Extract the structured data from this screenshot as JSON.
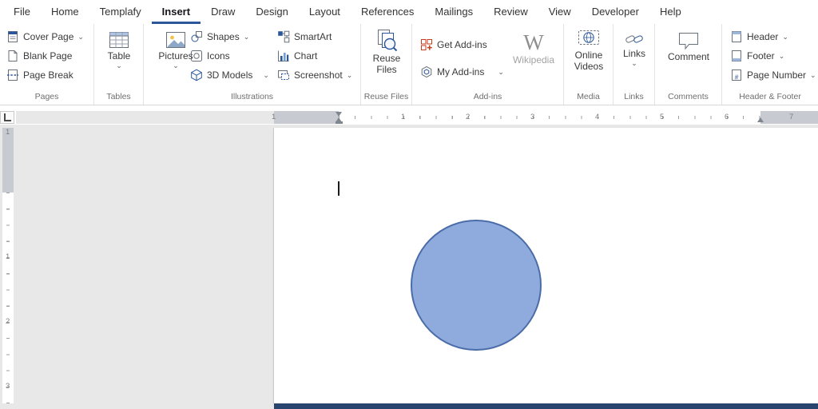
{
  "menu": {
    "tabs": [
      {
        "label": "File"
      },
      {
        "label": "Home"
      },
      {
        "label": "Templafy"
      },
      {
        "label": "Insert"
      },
      {
        "label": "Draw"
      },
      {
        "label": "Design"
      },
      {
        "label": "Layout"
      },
      {
        "label": "References"
      },
      {
        "label": "Mailings"
      },
      {
        "label": "Review"
      },
      {
        "label": "View"
      },
      {
        "label": "Developer"
      },
      {
        "label": "Help"
      }
    ],
    "active_tab": "Insert"
  },
  "ribbon": {
    "pages": {
      "group_label": "Pages",
      "cover_page": "Cover Page",
      "blank_page": "Blank Page",
      "page_break": "Page Break"
    },
    "tables": {
      "group_label": "Tables",
      "table": "Table"
    },
    "illustrations": {
      "group_label": "Illustrations",
      "pictures": "Pictures",
      "shapes": "Shapes",
      "icons": "Icons",
      "models_3d": "3D Models",
      "smartart": "SmartArt",
      "chart": "Chart",
      "screenshot": "Screenshot"
    },
    "reuse_files": {
      "group_label": "Reuse Files",
      "line1": "Reuse",
      "line2": "Files"
    },
    "addins": {
      "group_label": "Add-ins",
      "get_addins": "Get Add-ins",
      "my_addins": "My Add-ins",
      "wikipedia": "Wikipedia",
      "wikipedia_glyph": "W"
    },
    "media": {
      "group_label": "Media",
      "line1": "Online",
      "line2": "Videos"
    },
    "links": {
      "group_label": "Links",
      "links": "Links"
    },
    "comments": {
      "group_label": "Comments",
      "comment": "Comment"
    },
    "header_footer": {
      "group_label": "Header & Footer",
      "header": "Header",
      "footer": "Footer",
      "page_number": "Page Number"
    }
  },
  "ruler": {
    "h_numbers": [
      "1",
      "1",
      "2",
      "3",
      "4",
      "5",
      "6",
      "7"
    ],
    "v_numbers": [
      "1",
      "1",
      "2",
      "3"
    ]
  },
  "icons": {
    "chevron": "⌄"
  },
  "canvas": {
    "shape": "circle",
    "shape_fill": "#8FAADC",
    "shape_border": "#4A6CA8"
  },
  "colors": {
    "accent": "#2B579A",
    "status_bar": "#27456E"
  }
}
